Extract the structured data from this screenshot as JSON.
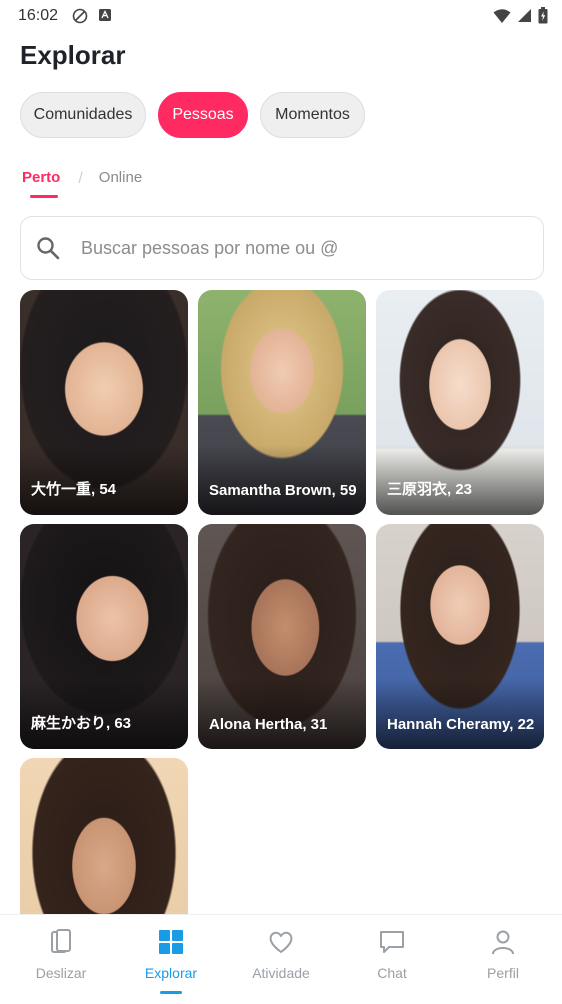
{
  "status": {
    "time": "16:02"
  },
  "header": {
    "title": "Explorar"
  },
  "segments": [
    {
      "label": "Comunidades",
      "active": false
    },
    {
      "label": "Pessoas",
      "active": true
    },
    {
      "label": "Momentos",
      "active": false
    }
  ],
  "subtabs": [
    {
      "label": "Perto",
      "active": true
    },
    {
      "label": "Online",
      "active": false
    }
  ],
  "search": {
    "placeholder": "Buscar pessoas por nome ou @",
    "value": ""
  },
  "people": [
    {
      "name": "大竹一重, 54"
    },
    {
      "name": "Samantha Brown, 59"
    },
    {
      "name": "三原羽衣, 23"
    },
    {
      "name": "麻生かおり, 63"
    },
    {
      "name": "Alona Hertha, 31"
    },
    {
      "name": "Hannah Cheramy, 22"
    },
    {
      "name": ""
    }
  ],
  "bottom_nav": [
    {
      "label": "Deslizar",
      "icon": "cards-icon",
      "active": false
    },
    {
      "label": "Explorar",
      "icon": "grid-icon",
      "active": true
    },
    {
      "label": "Atividade",
      "icon": "heart-icon",
      "active": false
    },
    {
      "label": "Chat",
      "icon": "chat-bubble-icon",
      "active": false
    },
    {
      "label": "Perfil",
      "icon": "person-icon",
      "active": false
    }
  ],
  "colors": {
    "accent": "#ff2a62",
    "nav_active": "#1a9be6"
  }
}
